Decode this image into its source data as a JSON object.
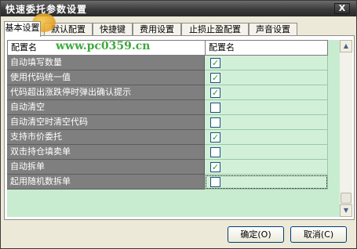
{
  "window": {
    "title": "快速委托参数设置",
    "close_label": "X"
  },
  "tabs": [
    {
      "label": "基本设置"
    },
    {
      "label": "默认配置"
    },
    {
      "label": "快捷键"
    },
    {
      "label": "费用设置"
    },
    {
      "label": "止损止盈配置"
    },
    {
      "label": "声音设置"
    }
  ],
  "grid": {
    "header_name": "配置名",
    "header_value": "配置名",
    "rows": [
      {
        "name": "自动填写数量",
        "checked": true
      },
      {
        "name": "使用代码统一值",
        "checked": true
      },
      {
        "name": "代码超出涨跌停时弹出确认提示",
        "checked": true
      },
      {
        "name": "自动清空",
        "checked": false
      },
      {
        "name": "自动清空时清空代码",
        "checked": false
      },
      {
        "name": "支持市价委托",
        "checked": true
      },
      {
        "name": "双击持仓填卖单",
        "checked": false
      },
      {
        "name": "自动拆单",
        "checked": true
      },
      {
        "name": "起用随机数拆单",
        "checked": false
      }
    ]
  },
  "watermark": "www.pc0359.cn",
  "buttons": {
    "ok": "确定(O)",
    "cancel": "取消(C)"
  },
  "colors": {
    "row_name_bg": "#7f7f7f",
    "row_value_bg": "#d2f0d8",
    "grid_bg": "#c8ecd0",
    "check": "#21a121"
  }
}
